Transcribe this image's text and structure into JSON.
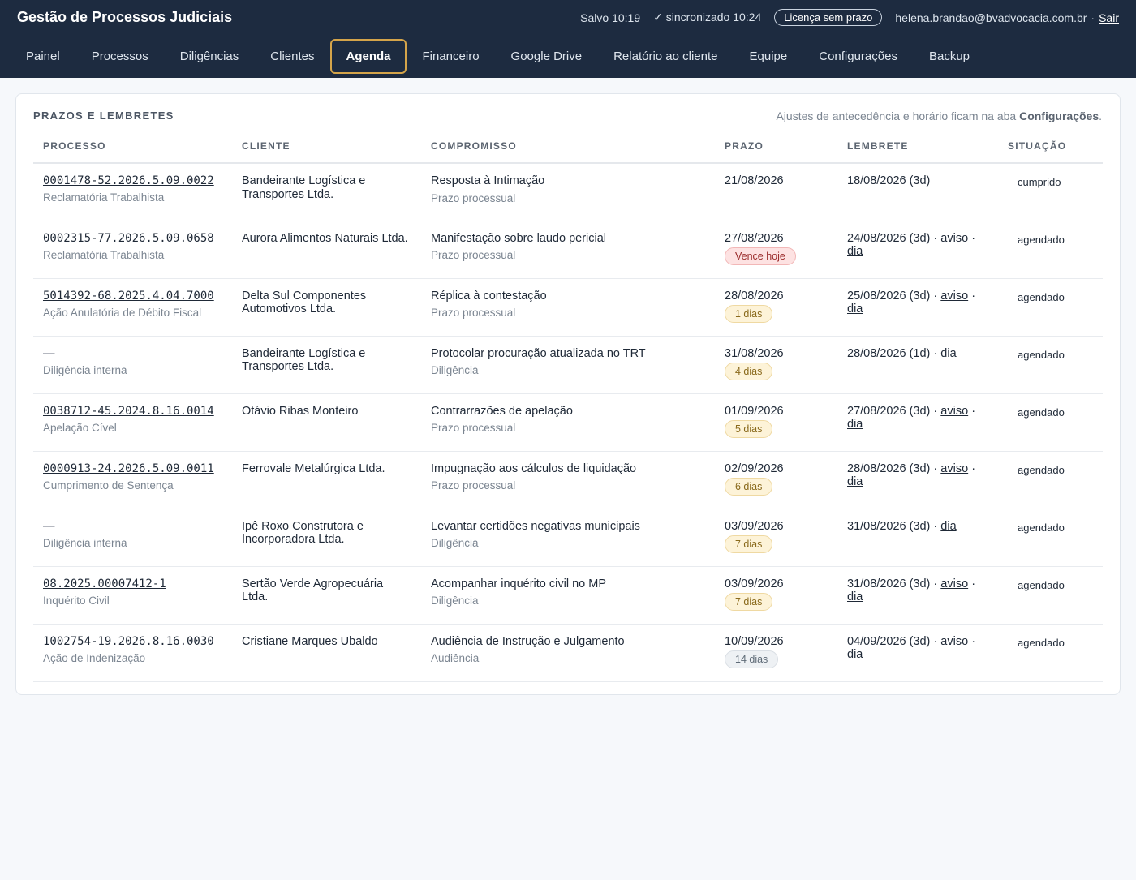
{
  "app": {
    "title": "Gestão de Processos Judiciais",
    "saved": "Salvo 10:19",
    "synced": "✓ sincronizado 10:24",
    "license": "Licença sem prazo",
    "user_email": "helena.brandao@bvadvocacia.com.br",
    "separator": "·",
    "logout": "Sair"
  },
  "nav": {
    "tabs": [
      {
        "label": "Painel"
      },
      {
        "label": "Processos"
      },
      {
        "label": "Diligências"
      },
      {
        "label": "Clientes"
      },
      {
        "label": "Agenda",
        "active": true
      },
      {
        "label": "Financeiro"
      },
      {
        "label": "Google Drive"
      },
      {
        "label": "Relatório ao cliente"
      },
      {
        "label": "Equipe"
      },
      {
        "label": "Configurações"
      },
      {
        "label": "Backup"
      }
    ]
  },
  "section": {
    "title": "PRAZOS E LEMBRETES",
    "hint_prefix": "Ajustes de antecedência e horário ficam na aba ",
    "hint_bold": "Configurações",
    "hint_suffix": "."
  },
  "table": {
    "headers": [
      "PROCESSO",
      "CLIENTE",
      "COMPROMISSO",
      "PRAZO",
      "LEMBRETE",
      "SITUAÇÃO"
    ],
    "rows": [
      {
        "processo": "0001478-52.2026.5.09.0022",
        "tipo": "Reclamatória Trabalhista",
        "cliente": "Bandeirante Logística e Transportes Ltda.",
        "compromisso": "Resposta à Intimação",
        "categoria": "Prazo processual",
        "prazo": "21/08/2026",
        "badge": "",
        "badge_style": "",
        "lembrete": "18/08/2026 (3d)",
        "links": [],
        "situacao": "cumprido"
      },
      {
        "processo": "0002315-77.2026.5.09.0658",
        "tipo": "Reclamatória Trabalhista",
        "cliente": "Aurora Alimentos Naturais Ltda.",
        "compromisso": "Manifestação sobre laudo pericial",
        "categoria": "Prazo processual",
        "prazo": "27/08/2026",
        "badge": "Vence hoje",
        "badge_style": "danger",
        "lembrete": "24/08/2026 (3d)",
        "links": [
          "aviso",
          "dia"
        ],
        "situacao": "agendado"
      },
      {
        "processo": "5014392-68.2025.4.04.7000",
        "tipo": "Ação Anulatória de Débito Fiscal",
        "cliente": "Delta Sul Componentes Automotivos Ltda.",
        "compromisso": "Réplica à contestação",
        "categoria": "Prazo processual",
        "prazo": "28/08/2026",
        "badge": "1 dias",
        "badge_style": "warn",
        "lembrete": "25/08/2026 (3d)",
        "links": [
          "aviso",
          "dia"
        ],
        "situacao": "agendado"
      },
      {
        "processo": "—",
        "tipo": "Diligência interna",
        "cliente": "Bandeirante Logística e Transportes Ltda.",
        "compromisso": "Protocolar procuração atualizada no TRT",
        "categoria": "Diligência",
        "prazo": "31/08/2026",
        "badge": "4 dias",
        "badge_style": "warn",
        "lembrete": "28/08/2026 (1d)",
        "links": [
          "dia"
        ],
        "situacao": "agendado"
      },
      {
        "processo": "0038712-45.2024.8.16.0014",
        "tipo": "Apelação Cível",
        "cliente": "Otávio Ribas Monteiro",
        "compromisso": "Contrarrazões de apelação",
        "categoria": "Prazo processual",
        "prazo": "01/09/2026",
        "badge": "5 dias",
        "badge_style": "warn",
        "lembrete": "27/08/2026 (3d)",
        "links": [
          "aviso",
          "dia"
        ],
        "situacao": "agendado"
      },
      {
        "processo": "0000913-24.2026.5.09.0011",
        "tipo": "Cumprimento de Sentença",
        "cliente": "Ferrovale Metalúrgica Ltda.",
        "compromisso": "Impugnação aos cálculos de liquidação",
        "categoria": "Prazo processual",
        "prazo": "02/09/2026",
        "badge": "6 dias",
        "badge_style": "warn",
        "lembrete": "28/08/2026 (3d)",
        "links": [
          "aviso",
          "dia"
        ],
        "situacao": "agendado"
      },
      {
        "processo": "—",
        "tipo": "Diligência interna",
        "cliente": "Ipê Roxo Construtora e Incorporadora Ltda.",
        "compromisso": "Levantar certidões negativas municipais",
        "categoria": "Diligência",
        "prazo": "03/09/2026",
        "badge": "7 dias",
        "badge_style": "warn",
        "lembrete": "31/08/2026 (3d)",
        "links": [
          "dia"
        ],
        "situacao": "agendado"
      },
      {
        "processo": "08.2025.00007412-1",
        "tipo": "Inquérito Civil",
        "cliente": "Sertão Verde Agropecuária Ltda.",
        "compromisso": "Acompanhar inquérito civil no MP",
        "categoria": "Diligência",
        "prazo": "03/09/2026",
        "badge": "7 dias",
        "badge_style": "warn",
        "lembrete": "31/08/2026 (3d)",
        "links": [
          "aviso",
          "dia"
        ],
        "situacao": "agendado"
      },
      {
        "processo": "1002754-19.2026.8.16.0030",
        "tipo": "Ação de Indenização",
        "cliente": "Cristiane Marques Ubaldo",
        "compromisso": "Audiência de Instrução e Julgamento",
        "categoria": "Audiência",
        "prazo": "10/09/2026",
        "badge": "14 dias",
        "badge_style": "muted",
        "lembrete": "04/09/2026 (3d)",
        "links": [
          "aviso",
          "dia"
        ],
        "situacao": "agendado"
      }
    ]
  }
}
